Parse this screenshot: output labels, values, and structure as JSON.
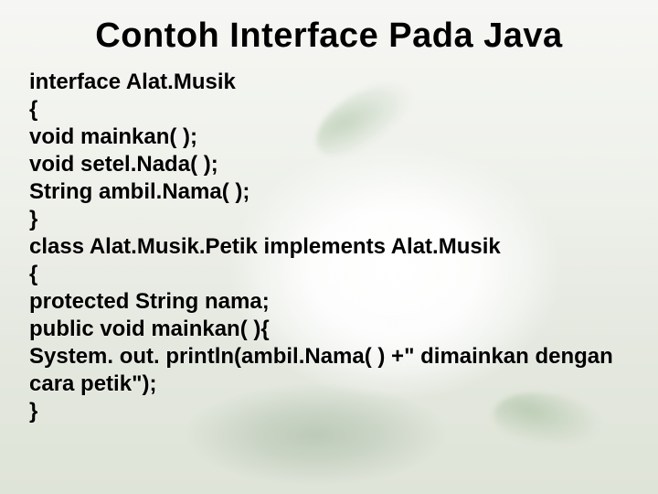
{
  "title": "Contoh Interface Pada Java",
  "code_lines": [
    "interface Alat.Musik",
    "{",
    "void mainkan( );",
    "void setel.Nada( );",
    "String ambil.Nama( );",
    "}",
    "class Alat.Musik.Petik implements Alat.Musik",
    "{",
    "protected String nama;",
    "public void mainkan( ){",
    "System. out. println(ambil.Nama( ) +\" dimainkan dengan cara petik\");",
    "}"
  ]
}
